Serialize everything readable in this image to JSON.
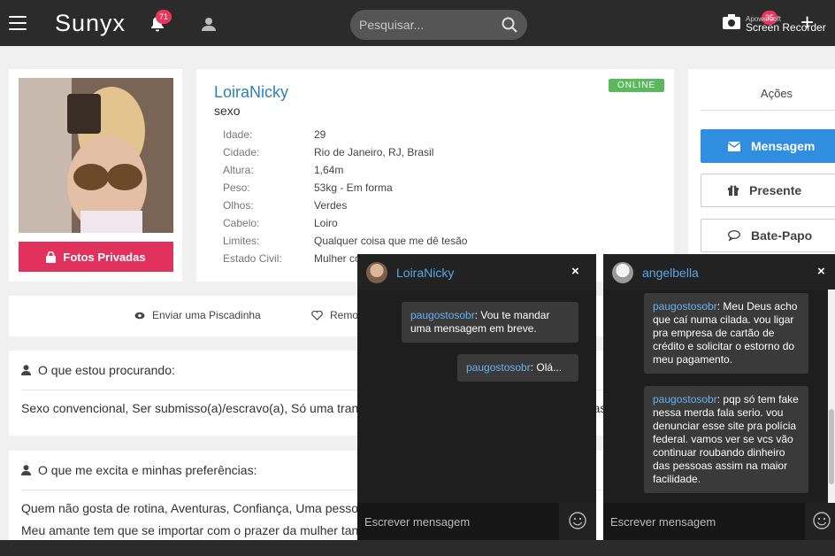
{
  "header": {
    "logo": "Sunyx",
    "notifications_count": "71",
    "search_placeholder": "Pesquisar...",
    "recorder_badge": "35",
    "recorder_small": "Apowersoft",
    "recorder_label": "Screen Recorder",
    "plus": "+"
  },
  "profile": {
    "private_photos_label": "Fotos Privadas",
    "name": "LoiraNicky",
    "gender": "sexo",
    "status": "ONLINE",
    "details": [
      {
        "label": "Idade:",
        "value": "29"
      },
      {
        "label": "Cidade:",
        "value": "Rio de Janeiro, RJ, Brasil"
      },
      {
        "label": "Altura:",
        "value": "1,64m"
      },
      {
        "label": "Peso:",
        "value": "53kg - Em forma"
      },
      {
        "label": "Olhos:",
        "value": "Verdes"
      },
      {
        "label": "Cabelo:",
        "value": "Loiro"
      },
      {
        "label": "Limites:",
        "value": "Qualquer coisa que me dê tesão"
      },
      {
        "label": "Estado Civil:",
        "value": "Mulher comprometida"
      }
    ]
  },
  "actions": {
    "title": "Ações",
    "message": "Mensagem",
    "gift": "Presente",
    "chat": "Bate-Papo"
  },
  "links": {
    "wink": "Enviar uma Piscadinha",
    "remove": "Remover dos favoritos"
  },
  "sections": {
    "looking_for_title": "O que estou procurando:",
    "looking_for_text": "Sexo convencional, Ser submisso(a)/escravo(a), Só uma transa, Experimentar coisas novas, Bom uso das mãos,",
    "excites_title": "O que me excita e minhas preferências:",
    "excites_line1": "Quem não gosta de rotina, Aventuras, Confiança, Uma pessoa",
    "excites_line2": "Meu amante tem que se importar com o prazer da mulher tanto"
  },
  "chat1": {
    "name": "LoiraNicky",
    "close": "×",
    "messages": [
      {
        "who": "paugostosobr",
        "text": ": Vou te mandar uma mensagem em breve."
      },
      {
        "who": "paugostosobr",
        "text": ": Olá..."
      }
    ],
    "input_placeholder": "Escrever mensagem"
  },
  "chat2": {
    "name": "angelbella",
    "close": "×",
    "messages": [
      {
        "who": "paugostosobr",
        "text": ": Meu Deus acho que caí numa cilada. vou ligar pra empresa de cartão de crédito e solicitar o estorno do meu pagamento."
      },
      {
        "who": "paugostosobr",
        "text": ": pqp só tem fake nessa merda fala serio. vou denunciar esse site pra polícia federal. vamos ver se vcs vão continuar roubando dinheiro das pessoas assim na maior facilidade."
      }
    ],
    "input_placeholder": "Escrever mensagem"
  }
}
